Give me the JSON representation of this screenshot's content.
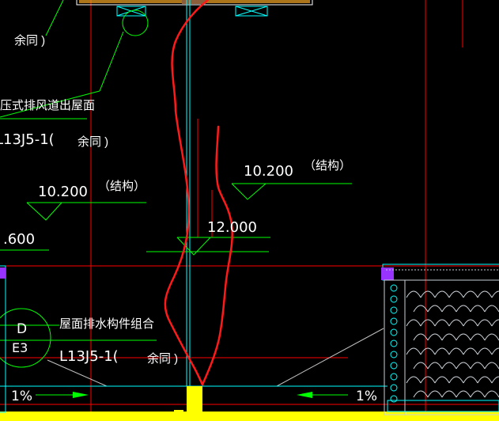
{
  "labels": {
    "note_top": "余同  )",
    "exhaust_title": "压式排风道出屋面",
    "exhaust_ref": "L13J5-1(",
    "exhaust_note": "余同  )",
    "elev_left_value": "10.200",
    "elev_left_note": "（结构）",
    "elev_right_value": "10.200",
    "elev_right_note": "（结构）",
    "elev_center_value": "12.000",
    "elev_partial": ".600",
    "drain_title": "屋面排水构件组合",
    "drain_ref": "L13J5-1(",
    "drain_note": "余同  )",
    "detail_letter": "D",
    "detail_sheet": "E3",
    "slope_left": "1%",
    "slope_right": "1%"
  },
  "colors": {
    "background": "#000000",
    "leader_green": "#00ff00",
    "cyan": "#00ffff",
    "grid_red": "#ff0000",
    "markup_red": "#ff1a1a",
    "text_white": "#ffffff",
    "yellow": "#ffff00",
    "purple": "#9933ff",
    "tile_gray": "#c8cfd6"
  }
}
